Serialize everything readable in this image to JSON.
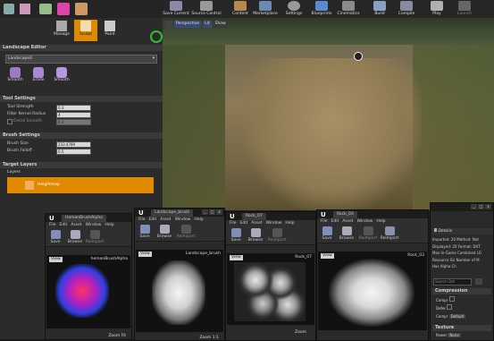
{
  "viewport_toolbar": {
    "buttons": [
      "Save Current",
      "Source Control",
      "Content",
      "Marketplace",
      "Settings",
      "Blueprints",
      "Cinematics",
      "Build",
      "Compile",
      "Play",
      "Launch"
    ],
    "viewport_modes": [
      "Perspective",
      "Lit",
      "Show"
    ]
  },
  "landscape": {
    "mode_tabs": [
      "Manage",
      "Sculpt",
      "Paint"
    ],
    "editor_header": "Landscape Editor",
    "landscape_select": "Landscape0",
    "tools": [
      "Smooth",
      "Erode",
      "Smooth"
    ],
    "tool_settings": {
      "header": "Tool Settings",
      "tool_strength_label": "Tool Strength",
      "tool_strength": "0.3",
      "filter_kernel_label": "Filter Kernel Radius",
      "filter_kernel": "4",
      "detail_smooth_label": "Detail Smooth",
      "detail_smooth": "0.3"
    },
    "brush_settings": {
      "header": "Brush Settings",
      "brush_size_label": "Brush Size",
      "brush_size": "233.4789",
      "brush_falloff_label": "Brush Falloff",
      "brush_falloff": "0.5"
    },
    "target_layers": {
      "header": "Target Layers",
      "layers_label": "Layers",
      "layer_name": "Heightmap"
    }
  },
  "windows": [
    {
      "tab": "HemanBrushAlpha",
      "menu": [
        "File",
        "Edit",
        "Asset",
        "Window",
        "Help"
      ],
      "tools": [
        "Save",
        "Browse",
        "Reimport"
      ],
      "view_label": "View",
      "asset_label": "hemanBrushAlpha",
      "zoom_label": "Zoom Fit"
    },
    {
      "tab": "Landscape_brush",
      "menu": [
        "File",
        "Edit",
        "Asset",
        "Window",
        "Help"
      ],
      "tools": [
        "Save",
        "Browse",
        "Reimport"
      ],
      "view_label": "View",
      "asset_label": "Landscape_brush",
      "zoom_label": "Zoom 1:1"
    },
    {
      "tab": "Rock_07",
      "menu": [
        "File",
        "Edit",
        "Asset",
        "Window",
        "Help"
      ],
      "tools": [
        "Save",
        "Browse",
        "Reimport"
      ],
      "view_label": "View",
      "asset_label": "Rock_07",
      "zoom_label": "Zoom"
    },
    {
      "tab": "Rock_03",
      "menu": [
        "File",
        "Edit",
        "Asset",
        "Window",
        "Help"
      ],
      "tools": [
        "Save",
        "Browse",
        "Reimport",
        "Reimport"
      ],
      "view_label": "View",
      "asset_label": "Rock_03",
      "zoom_label": ""
    }
  ],
  "details": {
    "header": "Details",
    "rows": [
      {
        "k": "Imported: 20",
        "v": "Method: Not"
      },
      {
        "k": "Displayed: 20",
        "v": "Format: DXT"
      },
      {
        "k": "Max In-Game",
        "v": "Combined LO"
      },
      {
        "k": "Resource Siz",
        "v": "Number of M"
      },
      {
        "k": "Has Alpha Ch",
        "v": ""
      }
    ],
    "search_placeholder": "Search Det",
    "compression": {
      "header": "Compression",
      "items": [
        "Compr",
        "Defer",
        "Compr"
      ],
      "compr_value": "Default"
    },
    "texture": {
      "header": "Texture",
      "power_label": "Power",
      "power_value": "None"
    }
  },
  "colors": {
    "accent_orange": "#e08a00",
    "ue_bg": "#1a1a1a"
  }
}
